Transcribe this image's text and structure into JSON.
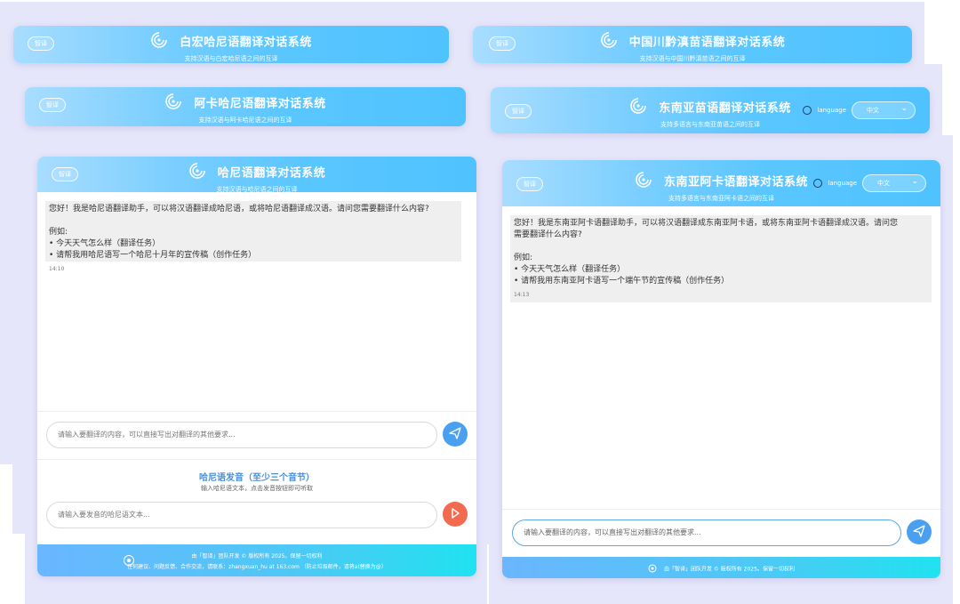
{
  "windows": {
    "w1": {
      "btn": "智译",
      "title": "白宏哈尼语翻译对话系统",
      "subtitle": "支持汉语与白宏哈尼语之间的互译"
    },
    "w2": {
      "btn": "智译",
      "title": "中国川黔滇苗语翻译对话系统",
      "subtitle": "支持汉语与中国川黔滇苗语之间的互译"
    },
    "w3": {
      "btn": "智译",
      "title": "阿卡哈尼语翻译对话系统",
      "subtitle": "支持汉语与阿卡哈尼语之间的互译"
    },
    "w4": {
      "btn": "智译",
      "title": "东南亚苗语翻译对话系统",
      "subtitle": "支持多语言与东南亚苗语之间的互译",
      "language_label": "language",
      "language_value": "中文"
    },
    "w5": {
      "btn": "智译",
      "title": "哈尼语翻译对话系统",
      "subtitle": "支持汉语与哈尼语之间的互译",
      "message": "您好！我是哈尼语翻译助手，可以将汉语翻译成哈尼语，或将哈尼语翻译成汉语。请问您需要翻译什么内容?\n\n例如:\n• 今天天气怎么样（翻译任务）\n• 请帮我用哈尼语写一个哈尼十月年的宣传稿（创作任务）",
      "time": "14:10",
      "input_placeholder": "请输入要翻译的内容，可以直接写出对翻译的其他要求...",
      "pron_title": "哈尼语发音（至少三个音节）",
      "pron_sub": "输入哈尼语文本，点击发音按钮即可听取",
      "pron_placeholder": "请输入要发音的哈尼语文本...",
      "footer_line1": "由「智译」团队开发 © 版权所有 2025。保留一切权利",
      "footer_line2": "任何建议、问题反馈、合作交流，请联系：zhangxuan_hu at 163.com （防止垃圾邮件，请将at替换为@）"
    },
    "w6": {
      "btn": "智译",
      "title": "东南亚阿卡语翻译对话系统",
      "subtitle": "支持多语言与东南亚阿卡语之间的互译",
      "language_label": "language",
      "language_value": "中文",
      "message": "您好！我是东南亚阿卡语翻译助手，可以将汉语翻译成东南亚阿卡语，或将东南亚阿卡语翻译成汉语。请问您\n需要翻译什么内容?\n\n例如:\n• 今天天气怎么样（翻译任务）\n• 请帮我用东南亚阿卡语写一个端午节的宣传稿（创作任务）",
      "time": "14:13",
      "input_placeholder": "请输入要翻译的内容，可以直接写出对翻译的其他要求...",
      "footer_line1": "由「智译」团队开发 © 版权所有 2025。保留一切权利"
    }
  },
  "colors": {
    "header": "#5ac6ff",
    "send": "#4a9ff0",
    "play": "#f26b4f",
    "frame": "#e6e6fa"
  },
  "icons": {
    "logo": "spiral-logo-icon",
    "send": "send-icon",
    "play": "play-icon",
    "footer": "footer-logo-icon",
    "language": "language-dot-icon"
  }
}
